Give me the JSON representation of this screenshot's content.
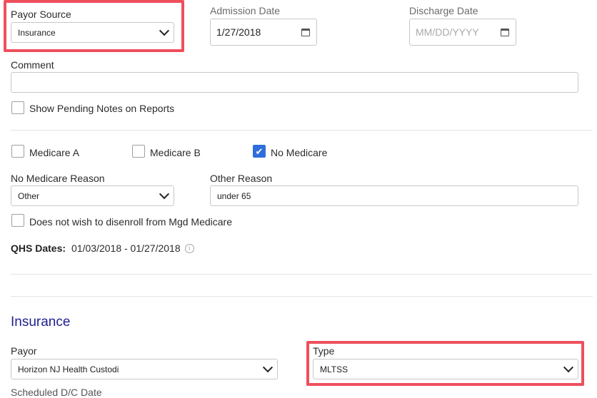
{
  "payor_source": {
    "label": "Payor Source",
    "value": "Insurance"
  },
  "admission_date": {
    "label": "Admission Date",
    "value": "1/27/2018"
  },
  "discharge_date": {
    "label": "Discharge Date",
    "placeholder": "MM/DD/YYYY"
  },
  "comment": {
    "label": "Comment",
    "value": ""
  },
  "show_pending_notes": {
    "label": "Show Pending Notes on Reports",
    "checked": false
  },
  "medicare": {
    "a": {
      "label": "Medicare A",
      "checked": false
    },
    "b": {
      "label": "Medicare B",
      "checked": false
    },
    "none": {
      "label": "No Medicare",
      "checked": true
    }
  },
  "no_medicare_reason": {
    "label": "No Medicare Reason",
    "value": "Other"
  },
  "other_reason": {
    "label": "Other Reason",
    "value": "under 65"
  },
  "disenroll": {
    "label": "Does not wish to disenroll from Mgd Medicare",
    "checked": false
  },
  "qhs": {
    "label": "QHS Dates:",
    "value": "01/03/2018 - 01/27/2018"
  },
  "insurance_section": {
    "title": "Insurance"
  },
  "payor": {
    "label": "Payor",
    "value": "Horizon NJ Health Custodi"
  },
  "type": {
    "label": "Type",
    "value": "MLTSS"
  },
  "scheduled_dc": {
    "label": "Scheduled D/C Date"
  },
  "colors": {
    "highlight": "#ee4f5c",
    "checkbox": "#2f6fdc",
    "section_title": "#1f1f8f"
  }
}
